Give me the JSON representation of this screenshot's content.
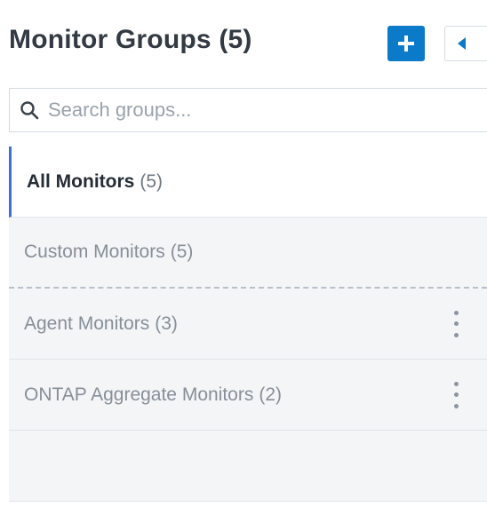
{
  "header": {
    "title": "Monitor Groups",
    "count": "(5)",
    "add_icon": "plus-icon",
    "collapse_icon": "caret-left-icon"
  },
  "search": {
    "placeholder": "Search groups...",
    "value": "",
    "icon": "search-icon"
  },
  "groups": [
    {
      "name": "All Monitors",
      "count": "(5)",
      "active": true
    },
    {
      "name": "Custom Monitors",
      "count": "(5)"
    },
    {
      "name": "Agent Monitors",
      "count": "(3)",
      "menu_icon": "more-vertical-icon"
    },
    {
      "name": "ONTAP Aggregate Monitors",
      "count": "(2)",
      "menu_icon": "more-vertical-icon"
    }
  ],
  "colors": {
    "accent": "#0b7ac9",
    "active_indicator": "#3f6fd1",
    "list_background": "#f3f5f7"
  }
}
